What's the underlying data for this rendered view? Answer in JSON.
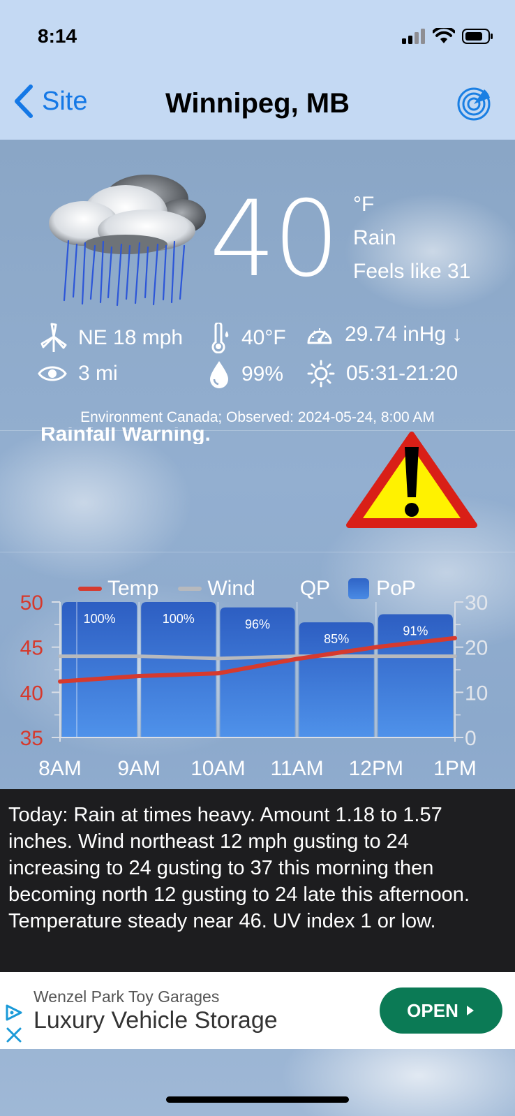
{
  "status_bar": {
    "time": "8:14"
  },
  "nav": {
    "back_label": "Site",
    "title": "Winnipeg, MB"
  },
  "current": {
    "temp": "40",
    "unit": "°F",
    "condition": "Rain",
    "feels_like": "Feels like 31",
    "wind": "NE 18 mph",
    "temp_detail": "40°F",
    "pressure": "29.74 inHg ↓",
    "visibility": "3 mi",
    "humidity": "99%",
    "sun": "05:31-21:20",
    "source": "Environment Canada; Observed: 2024-05-24, 8:00 AM"
  },
  "warning": {
    "text": "Rainfall Warning."
  },
  "legend": {
    "temp": "Temp",
    "wind": "Wind",
    "qp": "QP",
    "pop": "PoP"
  },
  "chart_data": {
    "type": "bar",
    "categories": [
      "8AM",
      "9AM",
      "10AM",
      "11AM",
      "12PM",
      "1PM"
    ],
    "series": [
      {
        "name": "PoP",
        "values": [
          100,
          100,
          96,
          85,
          91
        ],
        "labels": [
          "100%",
          "100%",
          "96%",
          "85%",
          "91%"
        ]
      },
      {
        "name": "Temp",
        "x": [
          8,
          9,
          10,
          11,
          12,
          13
        ],
        "values": [
          41.2,
          41.8,
          42.1,
          43.7,
          45.0,
          46.0
        ]
      },
      {
        "name": "Wind",
        "x": [
          8,
          9,
          10,
          11,
          12,
          13
        ],
        "values": [
          18,
          18,
          17.5,
          18,
          18,
          18
        ]
      }
    ],
    "y_left": {
      "range": [
        35,
        50
      ],
      "ticks": [
        "35",
        "40",
        "45",
        "50"
      ]
    },
    "y_right": {
      "range": [
        0,
        30
      ],
      "ticks": [
        "0",
        "10",
        "20",
        "30"
      ]
    },
    "colors": {
      "temp": "#d63a2e",
      "wind": "#b7b9bd",
      "bar_top": "#2d5ec2",
      "bar_bottom": "#4f92ea"
    }
  },
  "forecast": {
    "text": "Today:  Rain at times heavy. Amount 1.18 to 1.57 inches. Wind northeast 12 mph gusting to 24 increasing to 24 gusting to 37 this morning then becoming north 12 gusting to 24 late this afternoon. Temperature steady near 46. UV index 1 or low."
  },
  "ad": {
    "subtitle": "Wenzel Park Toy Garages",
    "title": "Luxury Vehicle Storage",
    "button": "OPEN"
  }
}
